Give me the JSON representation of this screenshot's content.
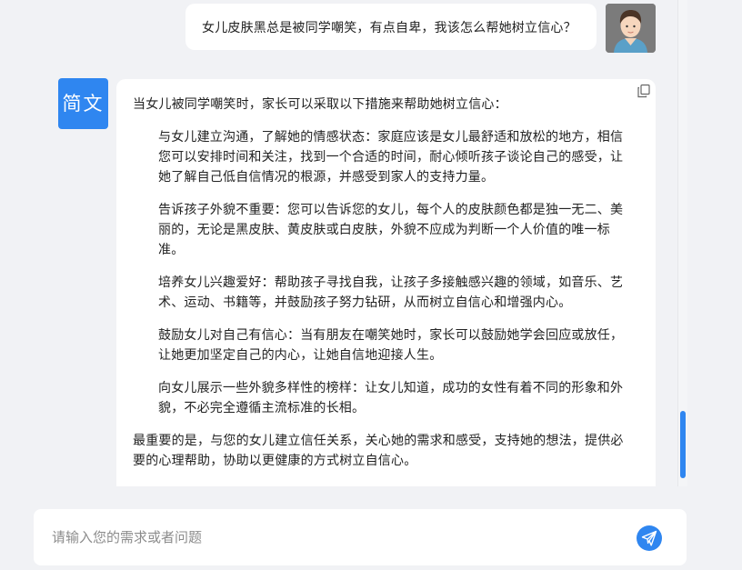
{
  "user_message": {
    "text": "女儿皮肤黑总是被同学嘲笑，有点自卑，我该怎么帮她树立信心？",
    "avatar_icon": "user-avatar-icon"
  },
  "bot": {
    "avatar_label": "简文",
    "copy_icon": "copy-icon",
    "answer": {
      "intro": "当女儿被同学嘲笑时，家长可以采取以下措施来帮助她树立信心：",
      "items": [
        "与女儿建立沟通，了解她的情感状态：家庭应该是女儿最舒适和放松的地方，相信您可以安排时间和关注，找到一个合适的时间，耐心倾听孩子谈论自己的感受，让她了解自己低自信情况的根源，并感受到家人的支持力量。",
        "告诉孩子外貌不重要：您可以告诉您的女儿，每个人的皮肤颜色都是独一无二、美丽的，无论是黑皮肤、黄皮肤或白皮肤，外貌不应成为判断一个人价值的唯一标准。",
        "培养女儿兴趣爱好：帮助孩子寻找自我，让孩子多接触感兴趣的领域，如音乐、艺术、运动、书籍等，并鼓励孩子努力钻研，从而树立自信心和增强内心。",
        "鼓励女儿对自己有信心：当有朋友在嘲笑她时，家长可以鼓励她学会回应或放任，让她更加坚定自己的内心，让她自信地迎接人生。",
        "向女儿展示一些外貌多样性的榜样：让女儿知道，成功的女性有着不同的形象和外貌，不必完全遵循主流标准的长相。"
      ],
      "outro": "最重要的是，与您的女儿建立信任关系，关心她的需求和感受，支持她的想法，提供必要的心理帮助，协助以更健康的方式树立自信心。"
    }
  },
  "input": {
    "value": "",
    "placeholder": "请输入您的需求或者问题",
    "send_icon": "send-icon"
  },
  "colors": {
    "accent": "#2f86f0",
    "page_background": "#f1f2f5",
    "card_background": "#ffffff",
    "placeholder_text": "#8c8c8c"
  }
}
